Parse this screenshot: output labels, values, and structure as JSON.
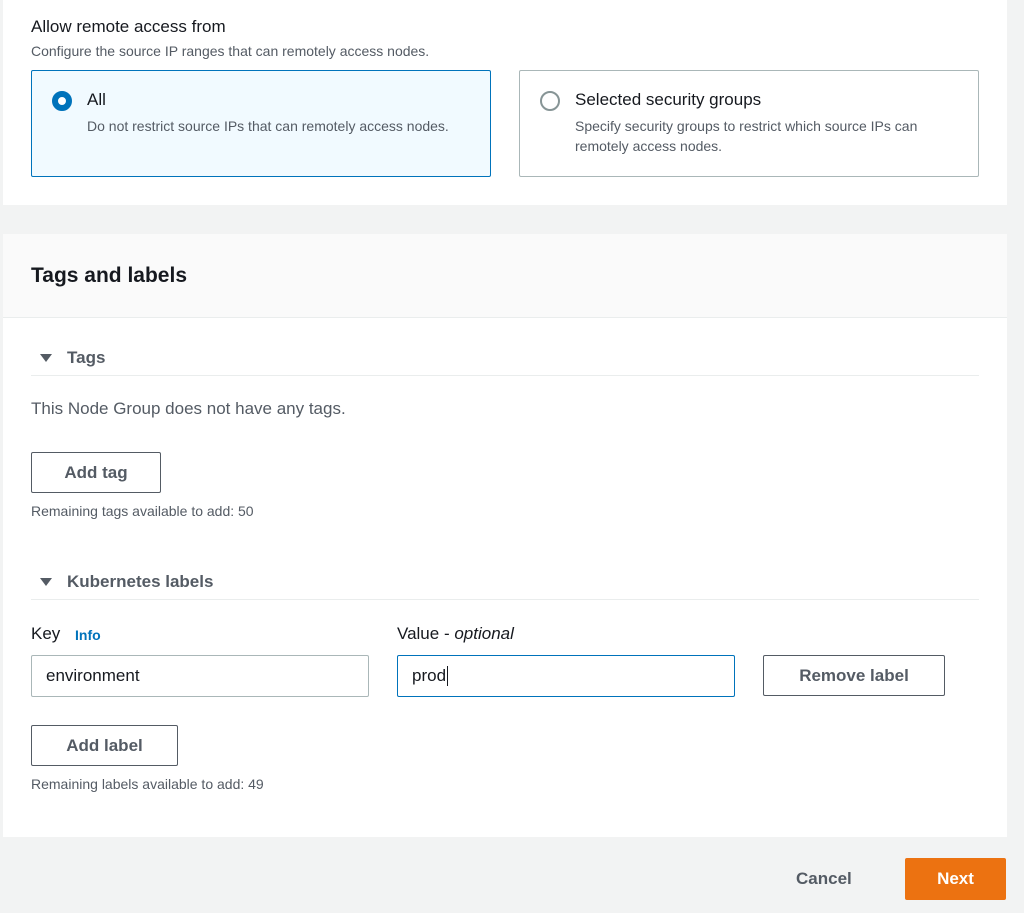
{
  "remote_access": {
    "title": "Allow remote access from",
    "description": "Configure the source IP ranges that can remotely access nodes.",
    "options": [
      {
        "label": "All",
        "description": "Do not restrict source IPs that can remotely access nodes.",
        "selected": true
      },
      {
        "label": "Selected security groups",
        "description": "Specify security groups to restrict which source IPs can remotely access nodes.",
        "selected": false
      }
    ]
  },
  "tags_section": {
    "title": "Tags and labels",
    "tags": {
      "header": "Tags",
      "empty_text": "This Node Group does not have any tags.",
      "add_button": "Add tag",
      "remaining": "Remaining tags available to add: 50"
    },
    "labels": {
      "header": "Kubernetes labels",
      "key_label": "Key",
      "info_link": "Info",
      "value_label": "Value - ",
      "value_optional": "optional",
      "rows": [
        {
          "key": "environment",
          "value": "prod"
        }
      ],
      "remove_button": "Remove label",
      "add_button": "Add label",
      "remaining": "Remaining labels available to add: 49"
    }
  },
  "footer": {
    "cancel": "Cancel",
    "next": "Next"
  },
  "colors": {
    "accent": "#0073bb",
    "primary_button": "#ec7211",
    "selected_tile_bg": "#f1faff"
  }
}
